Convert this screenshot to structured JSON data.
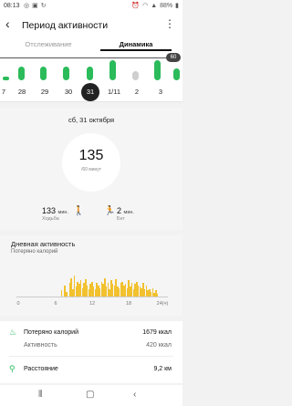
{
  "status_bar": {
    "time": "08:13",
    "battery": "88%",
    "left_icons": [
      "whatsapp-icon",
      "image-icon",
      "sync-icon"
    ],
    "right_icons": [
      "alarm-icon",
      "wifi-icon",
      "signal-icon",
      "battery-icon"
    ]
  },
  "header": {
    "title": "Период активности"
  },
  "tabs": [
    {
      "label": "Отслеживание",
      "active": false
    },
    {
      "label": "Динамика",
      "active": true
    }
  ],
  "goal_badge": "60",
  "week_bars": [
    {
      "fraction": 0.15,
      "color": "#2bbb5a"
    },
    {
      "fraction": 0.55,
      "color": "#2bbb5a"
    },
    {
      "fraction": 0.55,
      "color": "#2bbb5a"
    },
    {
      "fraction": 0.55,
      "color": "#2bbb5a"
    },
    {
      "fraction": 0.55,
      "color": "#2bbb5a"
    },
    {
      "fraction": 0.8,
      "color": "#2bbb5a"
    },
    {
      "fraction": 0.35,
      "color": "#cfcfcf"
    },
    {
      "fraction": 0.8,
      "color": "#2bbb5a"
    },
    {
      "fraction": 0.45,
      "color": "#2bbb5a"
    }
  ],
  "dates": [
    "7",
    "28",
    "29",
    "30",
    "31",
    "1/11",
    "2",
    "3"
  ],
  "selected_date": "31",
  "summary": {
    "date_title": "сб, 31 октября",
    "total": "135",
    "total_unit": "/60 минут",
    "walking_value": "133",
    "walking_unit": "мин.",
    "walking_label": "Ходьба",
    "running_value": "2",
    "running_unit": "мин.",
    "running_label": "Бег"
  },
  "daily_activity": {
    "title": "Дневная активность",
    "subtitle": "Потеряно калорий",
    "x_ticks": [
      "0",
      "6",
      "12",
      "18",
      "24(ч)"
    ]
  },
  "chart_data": {
    "type": "bar",
    "title": "Дневная активность",
    "xlabel": "",
    "ylabel": "",
    "x_ticks": [
      "0",
      "6",
      "12",
      "18",
      "24(ч)"
    ],
    "series": [
      {
        "values": [
          0,
          0,
          0,
          0,
          0,
          0,
          0,
          0,
          0,
          0,
          0,
          0,
          0,
          0,
          0,
          0,
          0,
          0,
          0,
          0,
          0,
          0,
          0,
          0,
          0,
          0,
          0,
          0,
          0.25,
          0,
          0.45,
          0.2,
          0,
          0.55,
          0.75,
          0.3,
          0.85,
          0.4,
          0.6,
          0.5,
          0.65,
          0.35,
          0.55,
          0.7,
          0.45,
          0.3,
          0.5,
          0.6,
          0.4,
          0.3,
          0.55,
          0.45,
          0.35,
          0.6,
          0.5,
          0.75,
          0.4,
          0.55,
          0.3,
          0.65,
          0.5,
          0.45,
          0.7,
          0.4,
          0.35,
          0.55,
          0.6,
          0.45,
          0.5,
          0.35,
          0.65,
          0.4,
          0.55,
          0.3,
          0.5,
          0.6,
          0.45,
          0.4,
          0.35,
          0.55,
          0.3,
          0.45,
          0.25,
          0.3,
          0.2,
          0.35,
          0.15,
          0.25,
          0.1,
          0,
          0,
          0,
          0,
          0,
          0
        ]
      }
    ]
  },
  "details": [
    {
      "icon": "flame-icon",
      "label": "Потеряно калорий",
      "value": "1679 ккал",
      "muted": false
    },
    {
      "icon": "",
      "label": "Активность",
      "value": "420 ккал",
      "muted": true
    },
    {
      "icon": "location-pin-icon",
      "label": "Расстояние",
      "value": "9,2 км",
      "muted": false
    }
  ],
  "colors": {
    "accent_green": "#2bbb5a",
    "chart_yellow": "#f2c12e",
    "walking_orange": "#f5a623",
    "running_green": "#2bbb5a"
  }
}
